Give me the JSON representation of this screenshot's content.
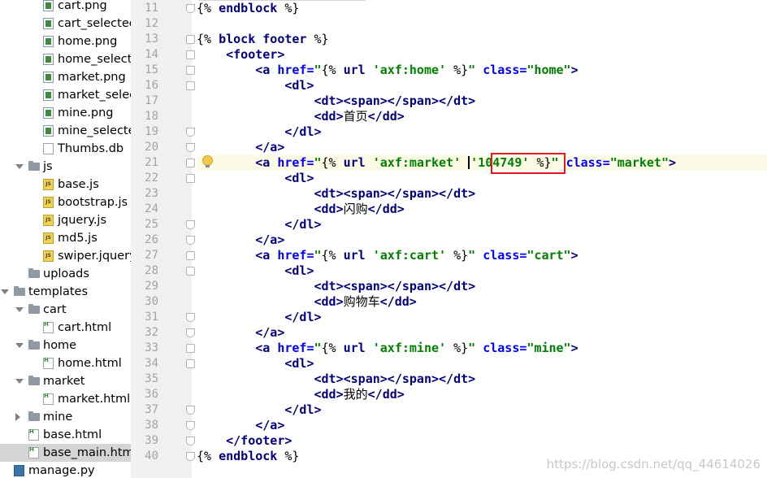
{
  "tree": [
    {
      "label": "cart.png",
      "indent": 71,
      "icon": "img",
      "arrow": null
    },
    {
      "label": "cart_selected.png",
      "indent": 71,
      "icon": "img",
      "arrow": null
    },
    {
      "label": "home.png",
      "indent": 71,
      "icon": "img",
      "arrow": null
    },
    {
      "label": "home_selected.png",
      "indent": 71,
      "icon": "img",
      "arrow": null
    },
    {
      "label": "market.png",
      "indent": 71,
      "icon": "img",
      "arrow": null
    },
    {
      "label": "market_selected.png",
      "indent": 71,
      "icon": "img",
      "arrow": null
    },
    {
      "label": "mine.png",
      "indent": 71,
      "icon": "img",
      "arrow": null
    },
    {
      "label": "mine_selected.png",
      "indent": 71,
      "icon": "img",
      "arrow": null
    },
    {
      "label": "Thumbs.db",
      "indent": 71,
      "icon": "db",
      "arrow": null
    },
    {
      "label": "js",
      "indent": 53,
      "icon": "folder",
      "arrow": "open"
    },
    {
      "label": "base.js",
      "indent": 71,
      "icon": "js",
      "arrow": null
    },
    {
      "label": "bootstrap.js",
      "indent": 71,
      "icon": "js",
      "arrow": null
    },
    {
      "label": "jquery.js",
      "indent": 71,
      "icon": "js",
      "arrow": null
    },
    {
      "label": "md5.js",
      "indent": 71,
      "icon": "js",
      "arrow": null
    },
    {
      "label": "swiper.jquery.js",
      "indent": 71,
      "icon": "js",
      "arrow": null
    },
    {
      "label": "uploads",
      "indent": 53,
      "icon": "folder",
      "arrow": null
    },
    {
      "label": "templates",
      "indent": 35,
      "icon": "folder",
      "arrow": "open"
    },
    {
      "label": "cart",
      "indent": 53,
      "icon": "folder",
      "arrow": "open"
    },
    {
      "label": "cart.html",
      "indent": 71,
      "icon": "html",
      "arrow": null
    },
    {
      "label": "home",
      "indent": 53,
      "icon": "folder",
      "arrow": "open"
    },
    {
      "label": "home.html",
      "indent": 71,
      "icon": "html",
      "arrow": null
    },
    {
      "label": "market",
      "indent": 53,
      "icon": "folder",
      "arrow": "open"
    },
    {
      "label": "market.html",
      "indent": 71,
      "icon": "html",
      "arrow": null
    },
    {
      "label": "mine",
      "indent": 53,
      "icon": "folder",
      "arrow": "closed"
    },
    {
      "label": "base.html",
      "indent": 53,
      "icon": "html",
      "arrow": null
    },
    {
      "label": "base_main.html",
      "indent": 53,
      "icon": "html",
      "arrow": null,
      "selected": true
    },
    {
      "label": "manage.py",
      "indent": 35,
      "icon": "py",
      "arrow": null
    }
  ],
  "editor": {
    "line_numbers": [
      "11",
      "12",
      "13",
      "14",
      "15",
      "16",
      "17",
      "18",
      "19",
      "20",
      "21",
      "22",
      "23",
      "24",
      "25",
      "26",
      "27",
      "28",
      "29",
      "30",
      "31",
      "32",
      "33",
      "34",
      "35",
      "36",
      "37",
      "38",
      "39",
      "40"
    ],
    "lines": [
      [
        [
          "plain",
          "{% "
        ],
        [
          "kw",
          "endblock"
        ],
        [
          "plain",
          " %}"
        ]
      ],
      [],
      [
        [
          "plain",
          "{% "
        ],
        [
          "kw",
          "block footer"
        ],
        [
          "plain",
          " %}"
        ]
      ],
      [
        [
          "plain",
          "    "
        ],
        [
          "tag",
          "<footer>"
        ]
      ],
      [
        [
          "plain",
          "        "
        ],
        [
          "tag",
          "<a "
        ],
        [
          "attr",
          "href="
        ],
        [
          "val",
          "\""
        ],
        [
          "plain",
          "{% "
        ],
        [
          "kw",
          "url"
        ],
        [
          "plain",
          " "
        ],
        [
          "val",
          "'axf:home'"
        ],
        [
          "plain",
          " %}"
        ],
        [
          "val",
          "\""
        ],
        [
          "plain",
          " "
        ],
        [
          "attr",
          "class="
        ],
        [
          "val",
          "\"home\""
        ],
        [
          "tag",
          ">"
        ]
      ],
      [
        [
          "plain",
          "            "
        ],
        [
          "tag",
          "<dl>"
        ]
      ],
      [
        [
          "plain",
          "                "
        ],
        [
          "tag",
          "<dt><span></span></dt>"
        ]
      ],
      [
        [
          "plain",
          "                "
        ],
        [
          "tag",
          "<dd>"
        ],
        [
          "plain",
          "首页"
        ],
        [
          "tag",
          "</dd>"
        ]
      ],
      [
        [
          "plain",
          "            "
        ],
        [
          "tag",
          "</dl>"
        ]
      ],
      [
        [
          "plain",
          "        "
        ],
        [
          "tag",
          "</a>"
        ]
      ],
      [
        [
          "plain",
          "        "
        ],
        [
          "tag",
          "<a "
        ],
        [
          "attr",
          "href="
        ],
        [
          "val",
          "\""
        ],
        [
          "plain",
          "{% "
        ],
        [
          "kw",
          "url"
        ],
        [
          "plain",
          " "
        ],
        [
          "val",
          "'axf:market'"
        ],
        [
          "plain",
          " "
        ],
        [
          "cursor",
          ""
        ],
        [
          "val",
          "'104749'"
        ],
        [
          "plain",
          " %}"
        ],
        [
          "val",
          "\""
        ],
        [
          "plain",
          " "
        ],
        [
          "attr",
          "class="
        ],
        [
          "val",
          "\"market\""
        ],
        [
          "tag",
          ">"
        ]
      ],
      [
        [
          "plain",
          "            "
        ],
        [
          "tag",
          "<dl>"
        ]
      ],
      [
        [
          "plain",
          "                "
        ],
        [
          "tag",
          "<dt><span></span></dt>"
        ]
      ],
      [
        [
          "plain",
          "                "
        ],
        [
          "tag",
          "<dd>"
        ],
        [
          "plain",
          "闪购"
        ],
        [
          "tag",
          "</dd>"
        ]
      ],
      [
        [
          "plain",
          "            "
        ],
        [
          "tag",
          "</dl>"
        ]
      ],
      [
        [
          "plain",
          "        "
        ],
        [
          "tag",
          "</a>"
        ]
      ],
      [
        [
          "plain",
          "        "
        ],
        [
          "tag",
          "<a "
        ],
        [
          "attr",
          "href="
        ],
        [
          "val",
          "\""
        ],
        [
          "plain",
          "{% "
        ],
        [
          "kw",
          "url"
        ],
        [
          "plain",
          " "
        ],
        [
          "val",
          "'axf:cart'"
        ],
        [
          "plain",
          " %}"
        ],
        [
          "val",
          "\""
        ],
        [
          "plain",
          " "
        ],
        [
          "attr",
          "class="
        ],
        [
          "val",
          "\"cart\""
        ],
        [
          "tag",
          ">"
        ]
      ],
      [
        [
          "plain",
          "            "
        ],
        [
          "tag",
          "<dl>"
        ]
      ],
      [
        [
          "plain",
          "                "
        ],
        [
          "tag",
          "<dt><span></span></dt>"
        ]
      ],
      [
        [
          "plain",
          "                "
        ],
        [
          "tag",
          "<dd>"
        ],
        [
          "plain",
          "购物车"
        ],
        [
          "tag",
          "</dd>"
        ]
      ],
      [
        [
          "plain",
          "            "
        ],
        [
          "tag",
          "</dl>"
        ]
      ],
      [
        [
          "plain",
          "        "
        ],
        [
          "tag",
          "</a>"
        ]
      ],
      [
        [
          "plain",
          "        "
        ],
        [
          "tag",
          "<a "
        ],
        [
          "attr",
          "href="
        ],
        [
          "val",
          "\""
        ],
        [
          "plain",
          "{% "
        ],
        [
          "kw",
          "url"
        ],
        [
          "plain",
          " "
        ],
        [
          "val",
          "'axf:mine'"
        ],
        [
          "plain",
          " %}"
        ],
        [
          "val",
          "\""
        ],
        [
          "plain",
          " "
        ],
        [
          "attr",
          "class="
        ],
        [
          "val",
          "\"mine\""
        ],
        [
          "tag",
          ">"
        ]
      ],
      [
        [
          "plain",
          "            "
        ],
        [
          "tag",
          "<dl>"
        ]
      ],
      [
        [
          "plain",
          "                "
        ],
        [
          "tag",
          "<dt><span></span></dt>"
        ]
      ],
      [
        [
          "plain",
          "                "
        ],
        [
          "tag",
          "<dd>"
        ],
        [
          "plain",
          "我的"
        ],
        [
          "tag",
          "</dd>"
        ]
      ],
      [
        [
          "plain",
          "            "
        ],
        [
          "tag",
          "</dl>"
        ]
      ],
      [
        [
          "plain",
          "        "
        ],
        [
          "tag",
          "</a>"
        ]
      ],
      [
        [
          "plain",
          "    "
        ],
        [
          "tag",
          "</footer>"
        ]
      ],
      [
        [
          "plain",
          "{% "
        ],
        [
          "kw",
          "endblock"
        ],
        [
          "plain",
          " %}"
        ]
      ]
    ],
    "highlighted_line": "21",
    "folds": [
      "11",
      "13",
      "14",
      "15",
      "16",
      "19",
      "20",
      "21",
      "22",
      "25",
      "26",
      "27",
      "28",
      "31",
      "32",
      "33",
      "34",
      "37",
      "38",
      "39",
      "40"
    ]
  },
  "watermark": "https://blog.csdn.net/qq_44614026"
}
